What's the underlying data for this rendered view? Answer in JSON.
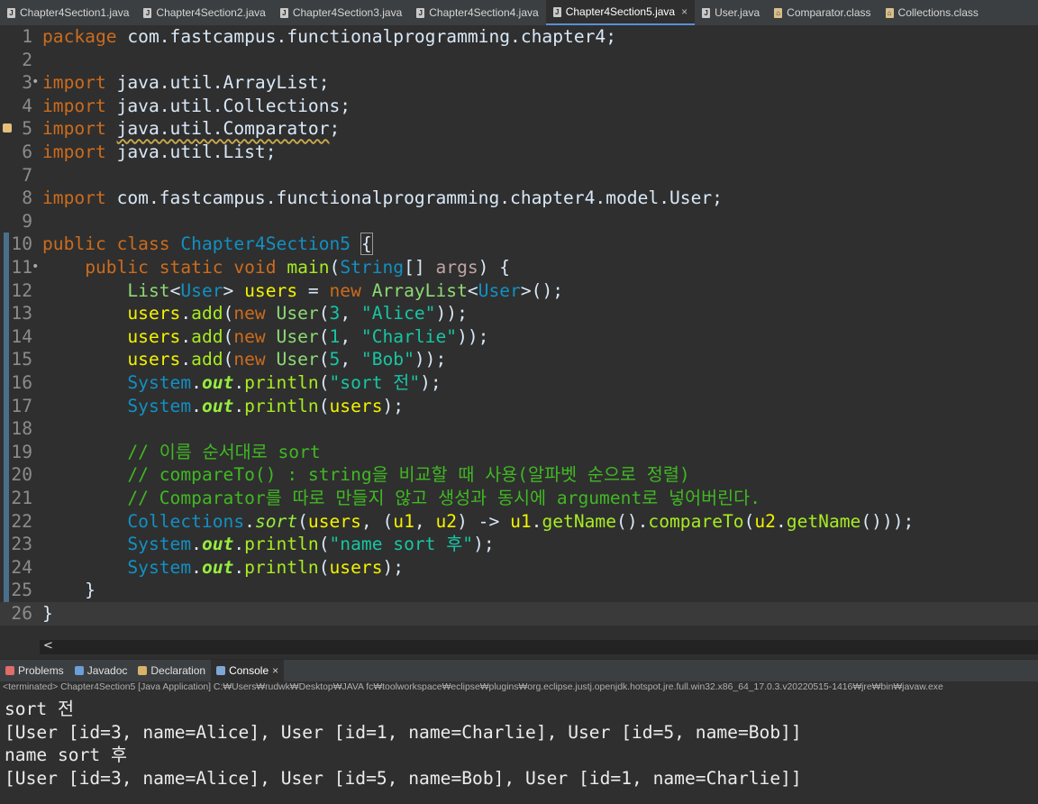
{
  "tabs": [
    {
      "label": "Chapter4Section1.java",
      "icon": "java-file-icon",
      "active": false
    },
    {
      "label": "Chapter4Section2.java",
      "icon": "java-file-icon",
      "active": false
    },
    {
      "label": "Chapter4Section3.java",
      "icon": "java-file-icon",
      "active": false
    },
    {
      "label": "Chapter4Section4.java",
      "icon": "java-file-icon",
      "active": false
    },
    {
      "label": "Chapter4Section5.java",
      "icon": "java-file-icon",
      "active": true
    },
    {
      "label": "User.java",
      "icon": "java-file-icon",
      "active": false
    },
    {
      "label": "Comparator.class",
      "icon": "class-file-icon",
      "active": false
    },
    {
      "label": "Collections.class",
      "icon": "class-file-icon",
      "active": false
    }
  ],
  "editor": {
    "active_line": 26,
    "lines": [
      {
        "n": "1",
        "tokens": [
          [
            "kw",
            "package"
          ],
          [
            "pl",
            " com.fastcampus.functionalprogramming.chapter4;"
          ]
        ]
      },
      {
        "n": "2",
        "tokens": []
      },
      {
        "n": "3",
        "fold": "•",
        "tokens": [
          [
            "kw",
            "import"
          ],
          [
            "pl",
            " java.util.ArrayList;"
          ]
        ]
      },
      {
        "n": "4",
        "tokens": [
          [
            "kw",
            "import"
          ],
          [
            "pl",
            " java.util.Collections;"
          ]
        ]
      },
      {
        "n": "5",
        "warn": true,
        "tokens": [
          [
            "kw",
            "import"
          ],
          [
            "pl",
            " "
          ],
          [
            "squig",
            "java.util.Comparator"
          ],
          [
            "pl",
            ";"
          ]
        ]
      },
      {
        "n": "6",
        "tokens": [
          [
            "kw",
            "import"
          ],
          [
            "pl",
            " java.util.List;"
          ]
        ]
      },
      {
        "n": "7",
        "tokens": []
      },
      {
        "n": "8",
        "tokens": [
          [
            "kw",
            "import"
          ],
          [
            "pl",
            " com.fastcampus.functionalprogramming.chapter4.model.User;"
          ]
        ]
      },
      {
        "n": "9",
        "tokens": []
      },
      {
        "n": "10",
        "tokens": [
          [
            "kw",
            "public"
          ],
          [
            "pl",
            " "
          ],
          [
            "kw",
            "class"
          ],
          [
            "pl",
            " "
          ],
          [
            "cls",
            "Chapter4Section5"
          ],
          [
            "pl",
            " "
          ],
          [
            "brace-box",
            "{"
          ]
        ]
      },
      {
        "n": "11",
        "fold": "•",
        "tokens": [
          [
            "pl",
            "    "
          ],
          [
            "kw",
            "public"
          ],
          [
            "pl",
            " "
          ],
          [
            "kw",
            "static"
          ],
          [
            "pl",
            " "
          ],
          [
            "kw",
            "void"
          ],
          [
            "pl",
            " "
          ],
          [
            "mth",
            "main"
          ],
          [
            "pl",
            "("
          ],
          [
            "cls",
            "String"
          ],
          [
            "pl",
            "[] "
          ],
          [
            "tparam",
            "args"
          ],
          [
            "pl",
            ") {"
          ]
        ]
      },
      {
        "n": "12",
        "tokens": [
          [
            "pl",
            "        "
          ],
          [
            "fld",
            "List"
          ],
          [
            "pl",
            "<"
          ],
          [
            "cls",
            "User"
          ],
          [
            "pl",
            "> "
          ],
          [
            "var",
            "users"
          ],
          [
            "pl",
            " = "
          ],
          [
            "kw",
            "new"
          ],
          [
            "pl",
            " "
          ],
          [
            "fld",
            "ArrayList"
          ],
          [
            "pl",
            "<"
          ],
          [
            "cls",
            "User"
          ],
          [
            "pl",
            ">();"
          ]
        ]
      },
      {
        "n": "13",
        "tokens": [
          [
            "pl",
            "        "
          ],
          [
            "var",
            "users"
          ],
          [
            "pl",
            "."
          ],
          [
            "mth",
            "add"
          ],
          [
            "pl",
            "("
          ],
          [
            "kw",
            "new"
          ],
          [
            "pl",
            " "
          ],
          [
            "fld",
            "User"
          ],
          [
            "pl",
            "("
          ],
          [
            "str",
            "3"
          ],
          [
            "pl",
            ", "
          ],
          [
            "str",
            "\"Alice\""
          ],
          [
            "pl",
            "));"
          ]
        ]
      },
      {
        "n": "14",
        "tokens": [
          [
            "pl",
            "        "
          ],
          [
            "var",
            "users"
          ],
          [
            "pl",
            "."
          ],
          [
            "mth",
            "add"
          ],
          [
            "pl",
            "("
          ],
          [
            "kw",
            "new"
          ],
          [
            "pl",
            " "
          ],
          [
            "fld",
            "User"
          ],
          [
            "pl",
            "("
          ],
          [
            "str",
            "1"
          ],
          [
            "pl",
            ", "
          ],
          [
            "str",
            "\"Charlie\""
          ],
          [
            "pl",
            "));"
          ]
        ]
      },
      {
        "n": "15",
        "tokens": [
          [
            "pl",
            "        "
          ],
          [
            "var",
            "users"
          ],
          [
            "pl",
            "."
          ],
          [
            "mth",
            "add"
          ],
          [
            "pl",
            "("
          ],
          [
            "kw",
            "new"
          ],
          [
            "pl",
            " "
          ],
          [
            "fld",
            "User"
          ],
          [
            "pl",
            "("
          ],
          [
            "str",
            "5"
          ],
          [
            "pl",
            ", "
          ],
          [
            "str",
            "\"Bob\""
          ],
          [
            "pl",
            "));"
          ]
        ]
      },
      {
        "n": "16",
        "tokens": [
          [
            "pl",
            "        "
          ],
          [
            "cls",
            "System"
          ],
          [
            "pl",
            "."
          ],
          [
            "stat",
            "out"
          ],
          [
            "pl",
            "."
          ],
          [
            "mth",
            "println"
          ],
          [
            "pl",
            "("
          ],
          [
            "str",
            "\"sort 전\""
          ],
          [
            "pl",
            ");"
          ]
        ]
      },
      {
        "n": "17",
        "tokens": [
          [
            "pl",
            "        "
          ],
          [
            "cls",
            "System"
          ],
          [
            "pl",
            "."
          ],
          [
            "stat",
            "out"
          ],
          [
            "pl",
            "."
          ],
          [
            "mth",
            "println"
          ],
          [
            "pl",
            "("
          ],
          [
            "var",
            "users"
          ],
          [
            "pl",
            ");"
          ]
        ]
      },
      {
        "n": "18",
        "tokens": []
      },
      {
        "n": "19",
        "tokens": [
          [
            "pl",
            "        "
          ],
          [
            "cmt",
            "// 이름 순서대로 sort"
          ]
        ]
      },
      {
        "n": "20",
        "tokens": [
          [
            "pl",
            "        "
          ],
          [
            "cmt",
            "// compareTo() : string을 비교할 때 사용(알파벳 순으로 정렬)"
          ]
        ]
      },
      {
        "n": "21",
        "tokens": [
          [
            "pl",
            "        "
          ],
          [
            "cmt",
            "// Comparator를 따로 만들지 않고 생성과 동시에 argument로 넣어버린다."
          ]
        ]
      },
      {
        "n": "22",
        "tokens": [
          [
            "pl",
            "        "
          ],
          [
            "cls",
            "Collections"
          ],
          [
            "pl",
            "."
          ],
          [
            "ital",
            "sort"
          ],
          [
            "pl",
            "("
          ],
          [
            "var",
            "users"
          ],
          [
            "pl",
            ", ("
          ],
          [
            "var",
            "u1"
          ],
          [
            "pl",
            ", "
          ],
          [
            "var",
            "u2"
          ],
          [
            "pl",
            ") -> "
          ],
          [
            "var",
            "u1"
          ],
          [
            "pl",
            "."
          ],
          [
            "mth",
            "getName"
          ],
          [
            "pl",
            "()."
          ],
          [
            "mth",
            "compareTo"
          ],
          [
            "pl",
            "("
          ],
          [
            "var",
            "u2"
          ],
          [
            "pl",
            "."
          ],
          [
            "mth",
            "getName"
          ],
          [
            "pl",
            "()));"
          ]
        ]
      },
      {
        "n": "23",
        "tokens": [
          [
            "pl",
            "        "
          ],
          [
            "cls",
            "System"
          ],
          [
            "pl",
            "."
          ],
          [
            "stat",
            "out"
          ],
          [
            "pl",
            "."
          ],
          [
            "mth",
            "println"
          ],
          [
            "pl",
            "("
          ],
          [
            "str",
            "\"name sort 후\""
          ],
          [
            "pl",
            ");"
          ]
        ]
      },
      {
        "n": "24",
        "tokens": [
          [
            "pl",
            "        "
          ],
          [
            "cls",
            "System"
          ],
          [
            "pl",
            "."
          ],
          [
            "stat",
            "out"
          ],
          [
            "pl",
            "."
          ],
          [
            "mth",
            "println"
          ],
          [
            "pl",
            "("
          ],
          [
            "var",
            "users"
          ],
          [
            "pl",
            ");"
          ]
        ]
      },
      {
        "n": "25",
        "tokens": [
          [
            "pl",
            "    }"
          ]
        ]
      },
      {
        "n": "26",
        "tokens": [
          [
            "pl",
            "}"
          ]
        ]
      }
    ]
  },
  "scroll": {
    "left_arrow": "<"
  },
  "views": [
    {
      "label": "Problems",
      "icon": "problems-icon",
      "active": false
    },
    {
      "label": "Javadoc",
      "icon": "javadoc-icon",
      "active": false
    },
    {
      "label": "Declaration",
      "icon": "declaration-icon",
      "active": false
    },
    {
      "label": "Console",
      "icon": "console-icon",
      "active": true
    }
  ],
  "console": {
    "status": "<terminated> Chapter4Section5 [Java Application] C:₩Users₩rudwk₩Desktop₩JAVA fc₩toolworkspace₩eclipse₩plugins₩org.eclipse.justj.openjdk.hotspot.jre.full.win32.x86_64_17.0.3.v20220515-1416₩jre₩bin₩javaw.exe",
    "output": [
      "sort 전",
      "[User [id=3, name=Alice], User [id=1, name=Charlie], User [id=5, name=Bob]]",
      "name sort 후",
      "[User [id=3, name=Alice], User [id=5, name=Bob], User [id=1, name=Charlie]]"
    ]
  },
  "colors": {
    "keyword": "#cc6c1d",
    "class": "#1290c3",
    "variable": "#f2f200",
    "string": "#17c6a3",
    "comment": "#40b823",
    "background": "#2f2f2f"
  }
}
